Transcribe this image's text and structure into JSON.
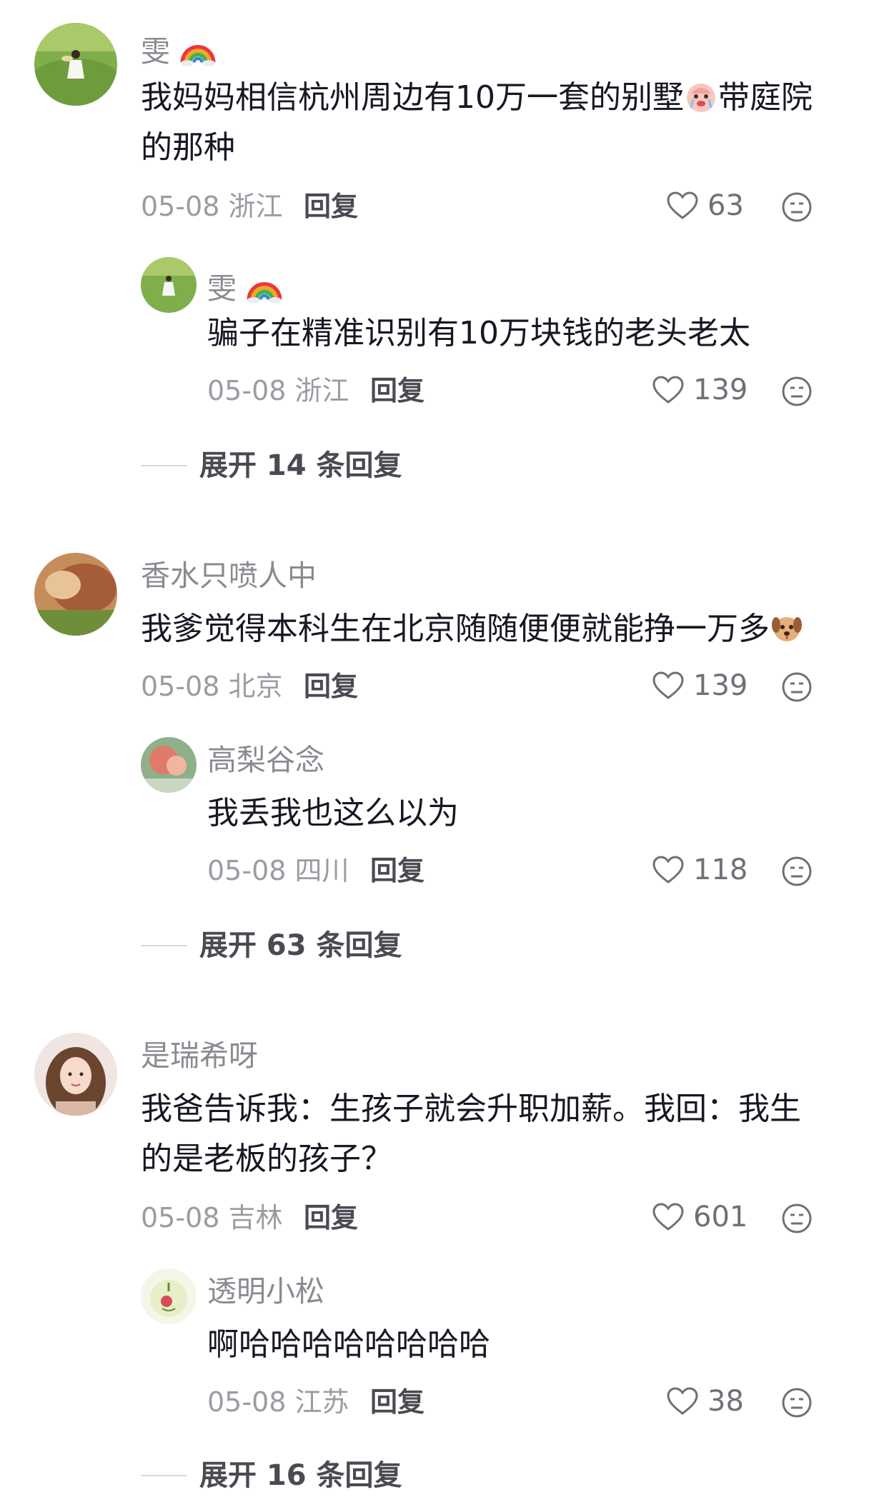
{
  "threads": [
    {
      "user": "雯",
      "text_before_emoji": "我妈妈相信杭州周边有10万一套的别墅",
      "text_after_emoji": "带庭院的那种",
      "emoji_icon": "crying-face-icon",
      "date": "05-08",
      "location": "浙江",
      "reply_label": "回复",
      "likes": "63",
      "reply": {
        "user": "雯",
        "text": "骗子在精准识别有10万块钱的老头老太",
        "date": "05-08",
        "location": "浙江",
        "reply_label": "回复",
        "likes": "139"
      },
      "expand_label": "展开 14 条回复"
    },
    {
      "user": "香水只喷人中",
      "text": "我爹觉得本科生在北京随随便便就能挣一万多",
      "emoji_icon": "dog-face-icon",
      "date": "05-08",
      "location": "北京",
      "reply_label": "回复",
      "likes": "139",
      "reply": {
        "user": "高梨谷念",
        "text": "我丢我也这么以为",
        "date": "05-08",
        "location": "四川",
        "reply_label": "回复",
        "likes": "118"
      },
      "expand_label": "展开 63 条回复"
    },
    {
      "user": "是瑞希呀",
      "text": "我爸告诉我：生孩子就会升职加薪。我回：我生的是老板的孩子？",
      "date": "05-08",
      "location": "吉林",
      "reply_label": "回复",
      "likes": "601",
      "reply": {
        "user": "透明小松",
        "text": "啊哈哈哈哈哈哈哈哈",
        "date": "05-08",
        "location": "江苏",
        "reply_label": "回复",
        "likes": "38"
      },
      "expand_label": "展开 16 条回复"
    }
  ],
  "colors": {
    "text": "#161823",
    "username": "#8a8b91",
    "meta": "#9b9ca3"
  }
}
